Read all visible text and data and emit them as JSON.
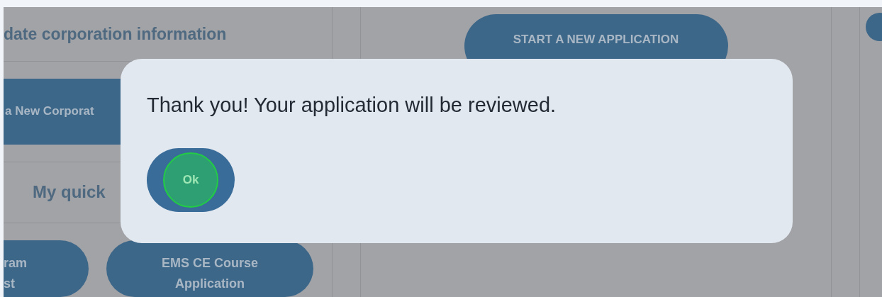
{
  "background": {
    "left_panel": {
      "heading": "date corporation information",
      "corporation_button": "a New Corporat",
      "quick_links_heading": "My quick",
      "quick_links": [
        {
          "lines": [
            "ram",
            "st"
          ]
        },
        {
          "lines": [
            "EMS CE Course",
            "Application"
          ]
        }
      ]
    },
    "center_panel": {
      "start_button": "START A NEW APPLICATION"
    }
  },
  "dialog": {
    "message": "Thank you! Your application will be reviewed.",
    "ok_button": "Ok"
  }
}
